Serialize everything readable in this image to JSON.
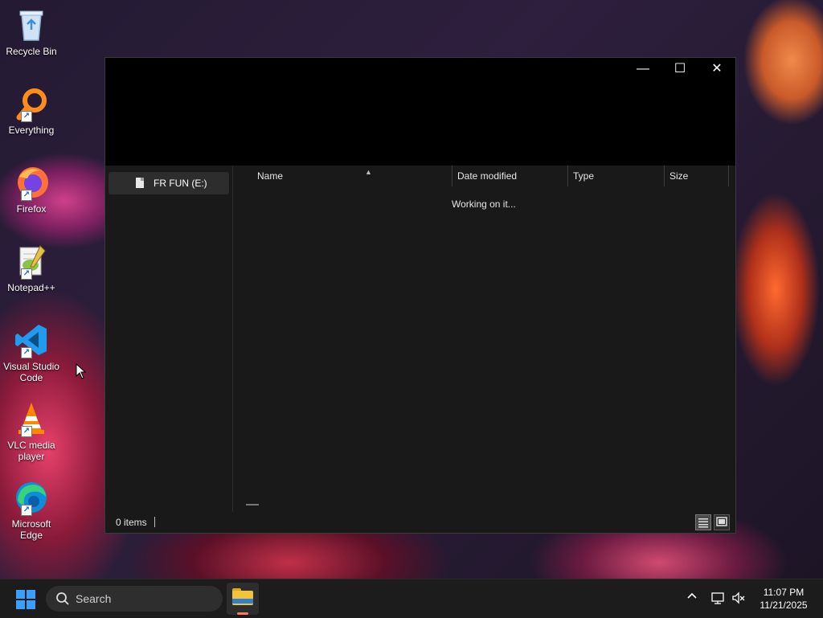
{
  "desktop": {
    "icons": [
      {
        "label": "Recycle Bin",
        "icon": "recycle-bin-icon"
      },
      {
        "label": "Everything",
        "icon": "everything-search-icon"
      },
      {
        "label": "Firefox",
        "icon": "firefox-icon"
      },
      {
        "label": "Notepad++",
        "icon": "notepad-plus-plus-icon"
      },
      {
        "label": "Visual Studio Code",
        "icon": "vscode-icon"
      },
      {
        "label": "VLC media player",
        "icon": "vlc-icon"
      },
      {
        "label": "Microsoft Edge",
        "icon": "edge-icon"
      }
    ]
  },
  "window": {
    "controls": {
      "minimize": "—",
      "maximize": "☐",
      "close": "✕"
    },
    "nav": {
      "item_label": "FR FUN (E:)"
    },
    "columns": [
      "Name",
      "Date modified",
      "Type",
      "Size"
    ],
    "loading_text": "Working on it...",
    "status": {
      "items": "0 items"
    }
  },
  "taskbar": {
    "search_placeholder": "Search",
    "clock": {
      "time": "11:07 PM",
      "date": "11/21/2025"
    },
    "tray": {
      "chevron": "^",
      "network": "network-icon",
      "volume": "volume-muted-icon"
    }
  },
  "colors": {
    "window_bg": "#191919",
    "titlebar_bg": "#000000",
    "taskbar_bg": "#1c1c1c",
    "accent": "#3aa0ff"
  }
}
